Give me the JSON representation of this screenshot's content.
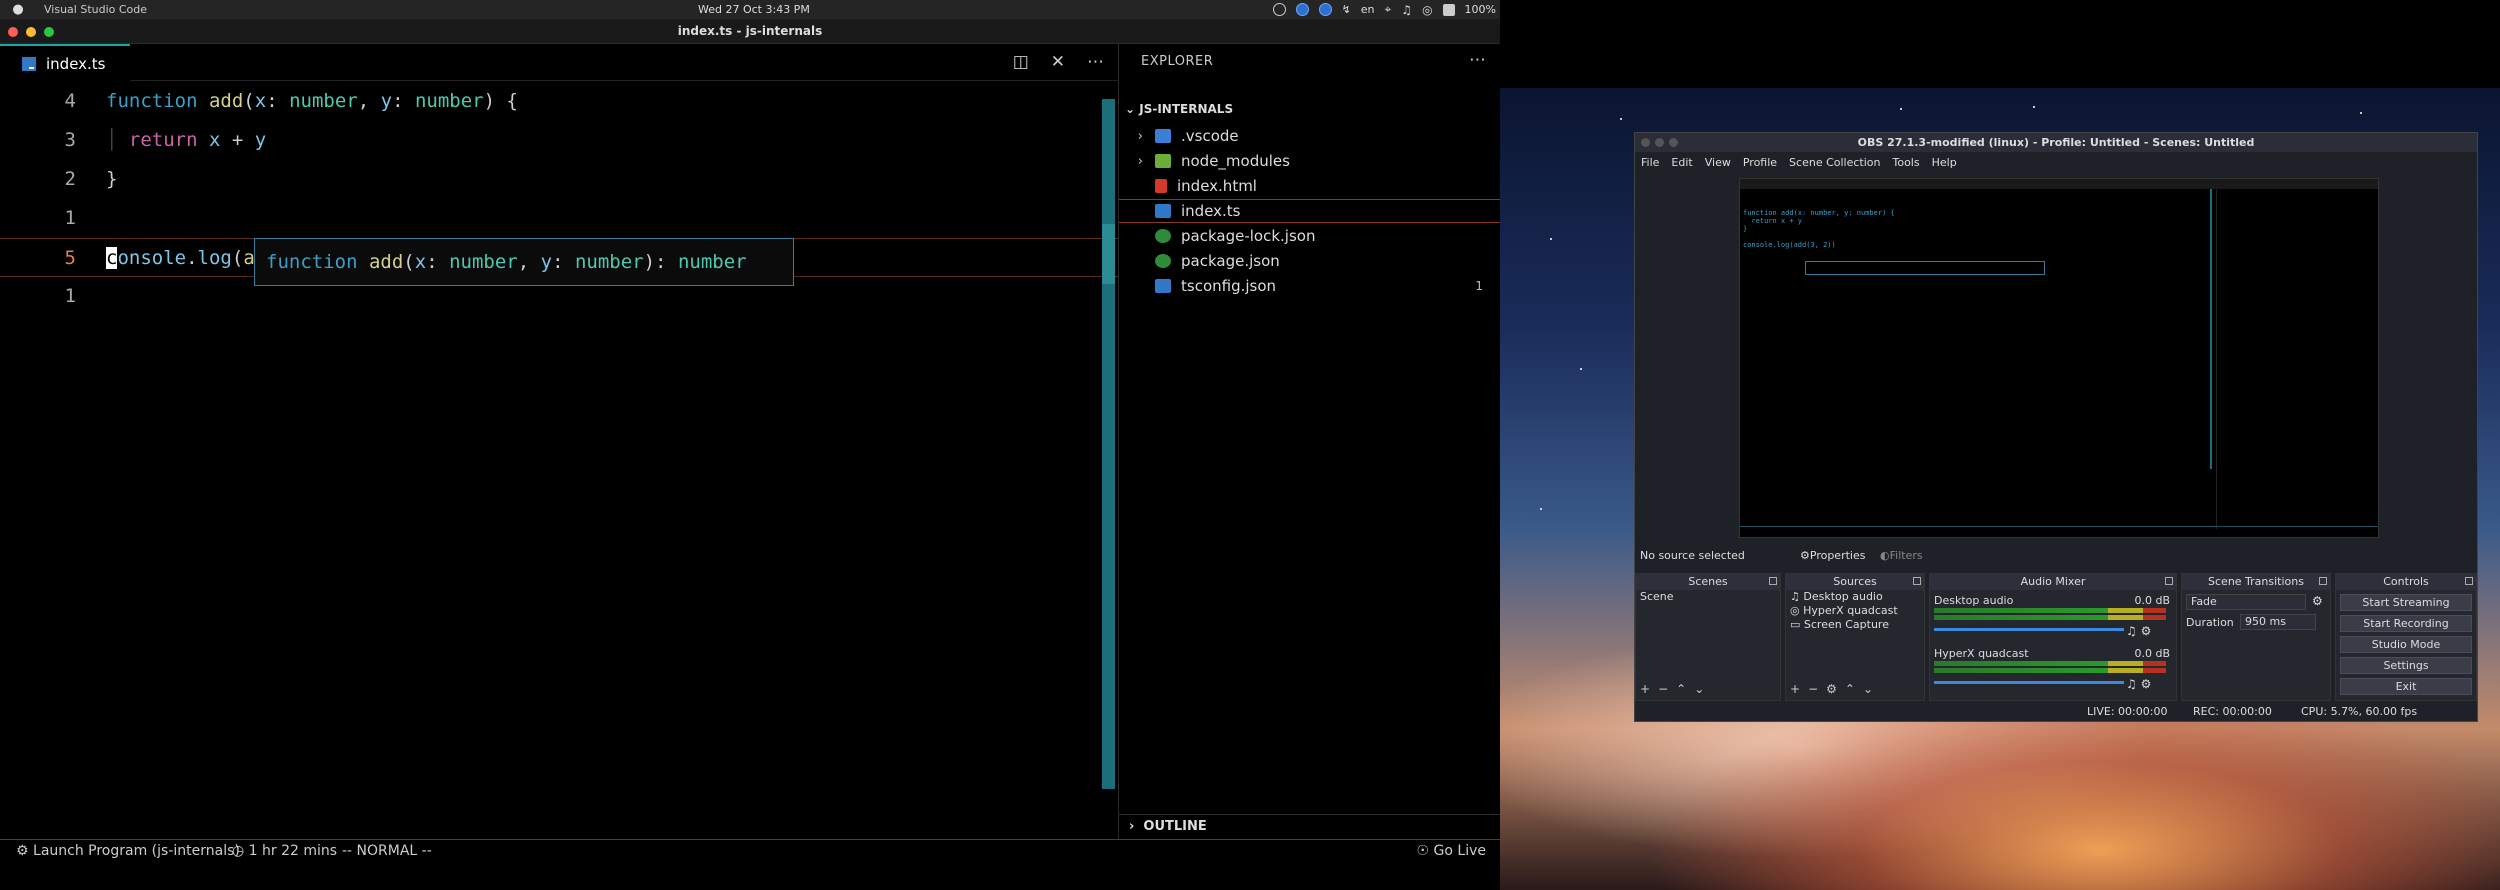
{
  "menubar": {
    "app_name": "Visual Studio Code",
    "clock": "Wed 27 Oct   3:43 PM",
    "lang": "en",
    "battery": "100%"
  },
  "vscode": {
    "window_title": "index.ts - js-internals",
    "tab_label": "index.ts",
    "code_lines": [
      {
        "ln": "4"
      },
      {
        "ln": "3"
      },
      {
        "ln": "2"
      },
      {
        "ln": "1"
      },
      {
        "ln": "5"
      },
      {
        "ln": "1"
      }
    ],
    "hover_text": "function add(x: number, y: number): number",
    "explorer": {
      "header": "EXPLORER",
      "root": "JS-INTERNALS",
      "items": [
        {
          "name": ".vscode",
          "badge": ""
        },
        {
          "name": "node_modules",
          "badge": ""
        },
        {
          "name": "index.html",
          "badge": ""
        },
        {
          "name": "index.ts",
          "badge": ""
        },
        {
          "name": "package-lock.json",
          "badge": ""
        },
        {
          "name": "package.json",
          "badge": ""
        },
        {
          "name": "tsconfig.json",
          "badge": "1"
        }
      ],
      "outline": "OUTLINE"
    },
    "statusbar": {
      "launch": "Launch Program (js-internals)",
      "time": "1 hr 22 mins",
      "mode": "-- NORMAL --",
      "go_live": "Go Live"
    }
  },
  "obs": {
    "title": "OBS 27.1.3-modified (linux) - Profile: Untitled - Scenes: Untitled",
    "menu": [
      "File",
      "Edit",
      "View",
      "Profile",
      "Scene Collection",
      "Tools",
      "Help"
    ],
    "no_source": "No source selected",
    "properties": "Properties",
    "filters": "Filters",
    "scenes_header": "Scenes",
    "scene_item": "Scene",
    "sources_header": "Sources",
    "sources": [
      "Desktop audio",
      "HyperX quadcast",
      "Screen Capture"
    ],
    "mixer_header": "Audio Mixer",
    "mixer": [
      {
        "name": "Desktop audio",
        "db": "0.0 dB"
      },
      {
        "name": "HyperX quadcast",
        "db": "0.0 dB"
      }
    ],
    "transitions_header": "Scene Transitions",
    "transition": "Fade",
    "duration_label": "Duration",
    "duration_value": "950 ms",
    "controls_header": "Controls",
    "controls": [
      "Start Streaming",
      "Start Recording",
      "Studio Mode",
      "Settings",
      "Exit"
    ],
    "status_live": "LIVE: 00:00:00",
    "status_rec": "REC: 00:00:00",
    "status_cpu": "CPU: 5.7%, 60.00 fps"
  },
  "colors": {
    "accent_teal": "#18a6a6",
    "ts_blue": "#3178c6"
  }
}
